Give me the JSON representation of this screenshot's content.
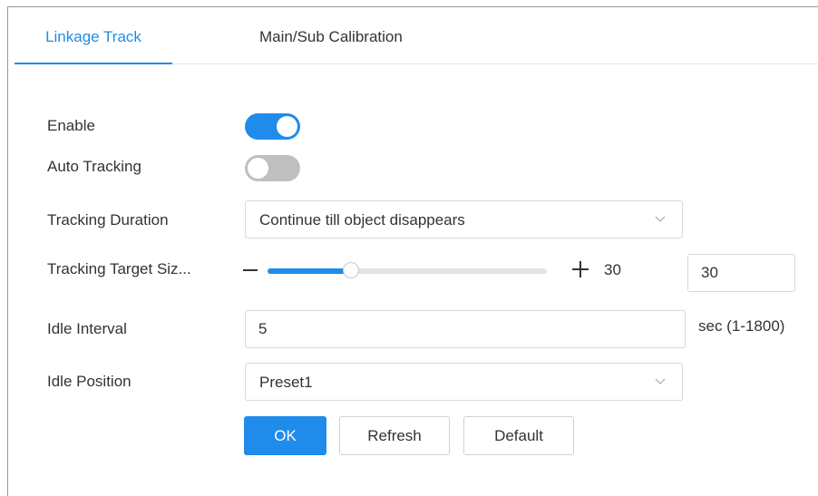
{
  "tabs": [
    {
      "label": "Linkage Track",
      "active": true
    },
    {
      "label": "Main/Sub Calibration",
      "active": false
    }
  ],
  "form": {
    "enable": {
      "label": "Enable",
      "on": true
    },
    "auto_tracking": {
      "label": "Auto Tracking",
      "on": false
    },
    "tracking_duration": {
      "label": "Tracking Duration",
      "value": "Continue till object disappears"
    },
    "tracking_target_size": {
      "label": "Tracking Target Siz...",
      "value": 30,
      "max": 100,
      "display": "30",
      "input_value": "30"
    },
    "idle_interval": {
      "label": "Idle Interval",
      "value": "5",
      "unit": "sec (1-1800)"
    },
    "idle_position": {
      "label": "Idle Position",
      "value": "Preset1"
    }
  },
  "buttons": {
    "ok": "OK",
    "refresh": "Refresh",
    "default": "Default"
  },
  "colors": {
    "accent": "#1f8ceb",
    "switch_off": "#bfbfbf"
  },
  "icons": {
    "dropdown": "chevron-down-icon",
    "decrease": "minus-icon",
    "increase": "plus-icon"
  }
}
